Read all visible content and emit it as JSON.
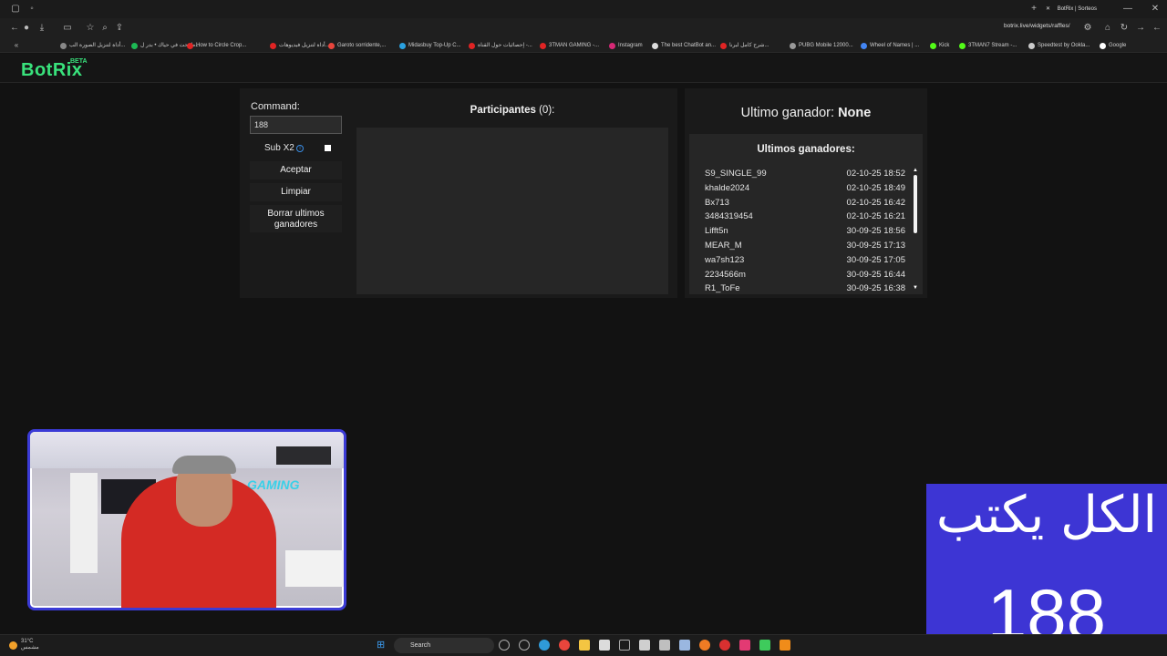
{
  "browser": {
    "tab_title": "BotRix | Sorteos",
    "url": "botrix.live/widgets/raffles/",
    "bookmarks": [
      {
        "label": "أداة لتنزيل الصورة الب...",
        "color": "#888888"
      },
      {
        "label": "طفحت في حياك • بدر ل...",
        "color": "#1db954"
      },
      {
        "label": "How to Circle Crop...",
        "color": "#e02424"
      },
      {
        "label": "أداة لتنزيل فيديوهات...",
        "color": "#e02424"
      },
      {
        "label": "Garoto sorridente,...",
        "color": "#e8453c"
      },
      {
        "label": "Midasbuy Top-Up C...",
        "color": "#2aa1e0"
      },
      {
        "label": "إحصائيات حول القناة -...",
        "color": "#e02424"
      },
      {
        "label": "3TMAN GAMING -...",
        "color": "#e02424"
      },
      {
        "label": "Instagram",
        "color": "#d62976"
      },
      {
        "label": "The best ChatBot an...",
        "color": "#dddddd"
      },
      {
        "label": "شرح كامل لبرنا...",
        "color": "#e02424"
      },
      {
        "label": "PUBG Mobile 12000...",
        "color": "#999999"
      },
      {
        "label": "Wheel of Names | ...",
        "color": "#4285f4"
      },
      {
        "label": "Kick",
        "color": "#53fc18"
      },
      {
        "label": "3TMAN7 Stream -...",
        "color": "#53fc18"
      },
      {
        "label": "Speedtest by Ookla...",
        "color": "#cccccc"
      },
      {
        "label": "Google",
        "color": "#ffffff"
      }
    ]
  },
  "site": {
    "logo": "BotRix",
    "beta": "BETA"
  },
  "raffle": {
    "command_label": "Command:",
    "command_value": "188",
    "sub_label": "Sub X2",
    "accept_label": "Aceptar",
    "clear_label": "Limpiar",
    "clear_winners_label": "Borrar ultimos ganadores",
    "participants_label": "Participantes",
    "participants_count": "(0):",
    "last_winner_label": "Ultimo ganador:",
    "last_winner_value": "None",
    "winners_title": "Ultimos ganadores:",
    "winners": [
      {
        "name": "S9_SINGLE_99",
        "date": "02-10-25 18:52"
      },
      {
        "name": "khalde2024",
        "date": "02-10-25 18:49"
      },
      {
        "name": "Bx713",
        "date": "02-10-25 16:42"
      },
      {
        "name": "3484319454",
        "date": "02-10-25 16:21"
      },
      {
        "name": "Lifft5n",
        "date": "30-09-25 18:56"
      },
      {
        "name": "MEAR_M",
        "date": "30-09-25 17:13"
      },
      {
        "name": "wa7sh123",
        "date": "30-09-25 17:05"
      },
      {
        "name": "2234566m",
        "date": "30-09-25 16:44"
      },
      {
        "name": "R1_ToFe",
        "date": "30-09-25 16:38"
      }
    ]
  },
  "webcam": {
    "wall_text": "GAMING"
  },
  "overlay": {
    "line1": "الكل يكتب",
    "line2": "188"
  },
  "taskbar": {
    "temperature": "31°C",
    "weather_text": "مشمس",
    "search_placeholder": "Search"
  }
}
